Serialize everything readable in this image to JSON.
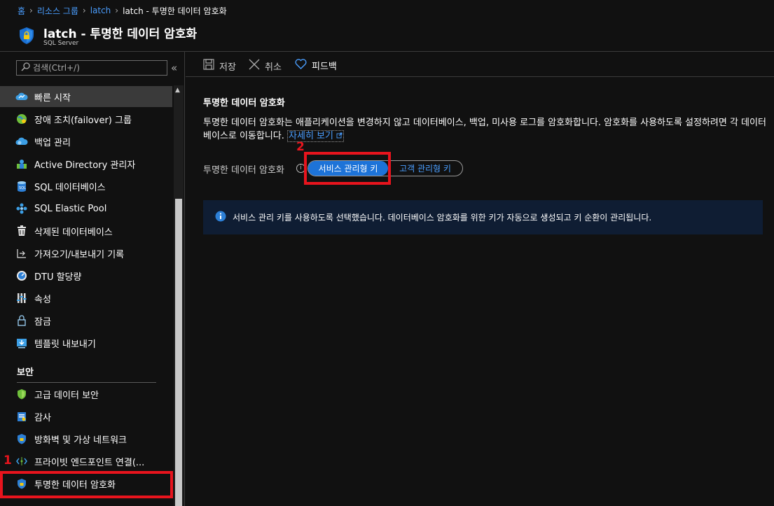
{
  "breadcrumb": {
    "items": [
      "홈",
      "리소스 그룹",
      "latch"
    ],
    "current": "latch - 투명한 데이터 암호화"
  },
  "header": {
    "title": "latch - 투명한 데이터 암호화",
    "subtitle": "SQL Server",
    "icon": "shield-icon"
  },
  "sidebar": {
    "search_placeholder": "검색(Ctrl+/)",
    "collapse_icon": "«",
    "items": [
      {
        "label": "빠른 시작",
        "icon": "cloud-icon",
        "active": true
      },
      {
        "label": "장애 조치(failover) 그룹",
        "icon": "globe-icon"
      },
      {
        "label": "백업 관리",
        "icon": "cloud-backup-icon"
      },
      {
        "label": "Active Directory 관리자",
        "icon": "ad-admin-icon"
      },
      {
        "label": "SQL 데이터베이스",
        "icon": "database-icon"
      },
      {
        "label": "SQL Elastic Pool",
        "icon": "elastic-pool-icon"
      },
      {
        "label": "삭제된 데이터베이스",
        "icon": "trash-icon"
      },
      {
        "label": "가져오기/내보내기 기록",
        "icon": "import-export-icon"
      },
      {
        "label": "DTU 할당량",
        "icon": "gauge-icon"
      },
      {
        "label": "속성",
        "icon": "properties-icon"
      },
      {
        "label": "잠금",
        "icon": "lock-icon"
      },
      {
        "label": "템플릿 내보내기",
        "icon": "download-template-icon"
      }
    ],
    "section_title": "보안",
    "security_items": [
      {
        "label": "고급 데이터 보안",
        "icon": "shield-green-icon"
      },
      {
        "label": "감사",
        "icon": "audit-icon"
      },
      {
        "label": "방화벽 및 가상 네트워크",
        "icon": "firewall-shield-icon"
      },
      {
        "label": "프라이빗 엔드포인트 연결(...",
        "icon": "endpoint-icon"
      },
      {
        "label": "투명한 데이터 암호화",
        "icon": "shield-icon",
        "highlighted": true
      }
    ]
  },
  "toolbar": {
    "save_label": "저장",
    "cancel_label": "취소",
    "feedback_label": "피드백"
  },
  "content": {
    "title": "투명한 데이터 암호화",
    "description": "투명한 데이터 암호화는 애플리케이션을 변경하지 않고 데이터베이스, 백업, 미사용 로그를 암호화합니다. 암호화를 사용하도록 설정하려면 각 데이터베이스로 이동합니다.",
    "learn_more": "자세히 보기",
    "field_label": "투명한 데이터 암호화",
    "options": [
      "서비스 관리형 키",
      "고객 관리형 키"
    ],
    "selected_option": "서비스 관리형 키",
    "info_message": "서비스 관리 키를 사용하도록 선택했습니다. 데이터베이스 암호화를 위한 키가 자동으로 생성되고 키 순환이 관리됩니다."
  },
  "callouts": [
    "1",
    "2"
  ],
  "colors": {
    "accent": "#1d73d8",
    "link": "#4a9eff",
    "callout": "#e8141d",
    "info_bg": "#0f1d33"
  }
}
